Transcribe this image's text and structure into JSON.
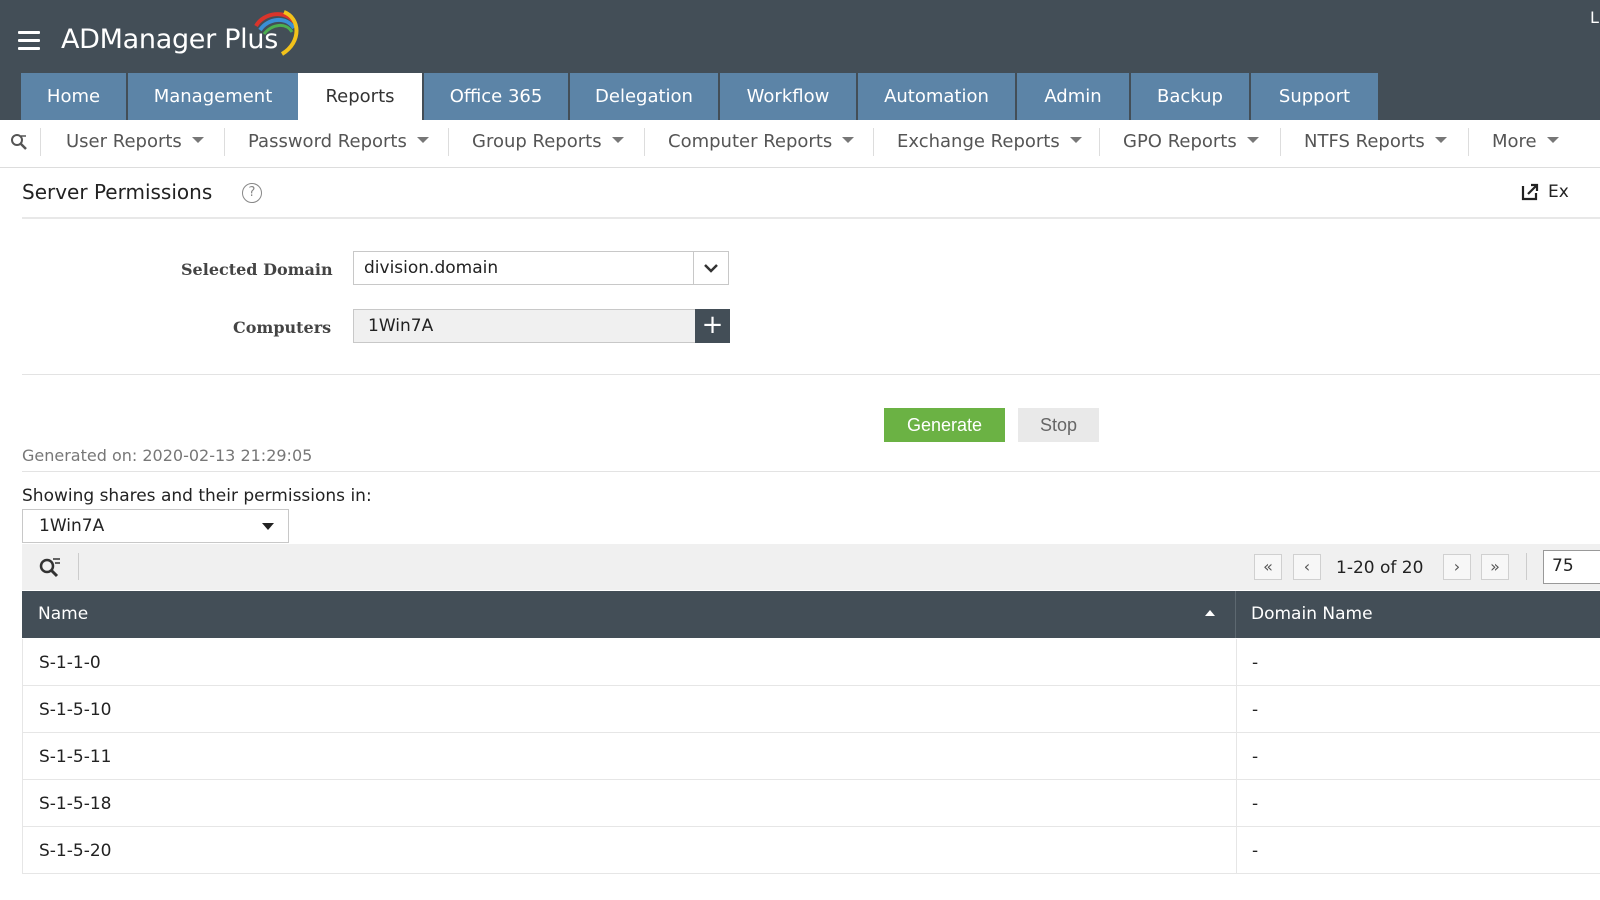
{
  "header": {
    "app_name": "ADManager Plus",
    "top_right_text": "L",
    "colors": {
      "header_bg": "#434e57",
      "tab_bg": "#5c84a7",
      "accent_green": "#6bb244"
    }
  },
  "main_tabs": [
    {
      "label": "Home",
      "active": false
    },
    {
      "label": "Management",
      "active": false
    },
    {
      "label": "Reports",
      "active": true
    },
    {
      "label": "Office 365",
      "active": false
    },
    {
      "label": "Delegation",
      "active": false
    },
    {
      "label": "Workflow",
      "active": false
    },
    {
      "label": "Automation",
      "active": false
    },
    {
      "label": "Admin",
      "active": false
    },
    {
      "label": "Backup",
      "active": false
    },
    {
      "label": "Support",
      "active": false
    }
  ],
  "sub_nav": [
    {
      "label": "User Reports"
    },
    {
      "label": "Password Reports"
    },
    {
      "label": "Group Reports"
    },
    {
      "label": "Computer Reports"
    },
    {
      "label": "Exchange Reports"
    },
    {
      "label": "GPO Reports"
    },
    {
      "label": "NTFS Reports"
    },
    {
      "label": "More"
    }
  ],
  "page": {
    "title": "Server Permissions",
    "help_icon": "?",
    "export_label": "Ex"
  },
  "form": {
    "domain_label": "Selected Domain",
    "domain_value": "division.domain",
    "computers_label": "Computers",
    "computers_value": "1Win7A",
    "add_icon": "+"
  },
  "actions": {
    "generate_label": "Generate",
    "stop_label": "Stop"
  },
  "report": {
    "generated_on": "Generated on: 2020-02-13 21:29:05",
    "showing_label": "Showing shares and their permissions in:",
    "share_selected": "1Win7A"
  },
  "pagination": {
    "first": "«",
    "prev": "‹",
    "range_text": "1-20 of 20",
    "next": "›",
    "last": "»",
    "page_size": "75"
  },
  "table": {
    "columns": [
      "Name",
      "Domain Name"
    ],
    "rows": [
      {
        "name": "S-1-1-0",
        "domain": "-"
      },
      {
        "name": "S-1-5-10",
        "domain": "-"
      },
      {
        "name": "S-1-5-11",
        "domain": "-"
      },
      {
        "name": "S-1-5-18",
        "domain": "-"
      },
      {
        "name": "S-1-5-20",
        "domain": "-"
      }
    ]
  }
}
